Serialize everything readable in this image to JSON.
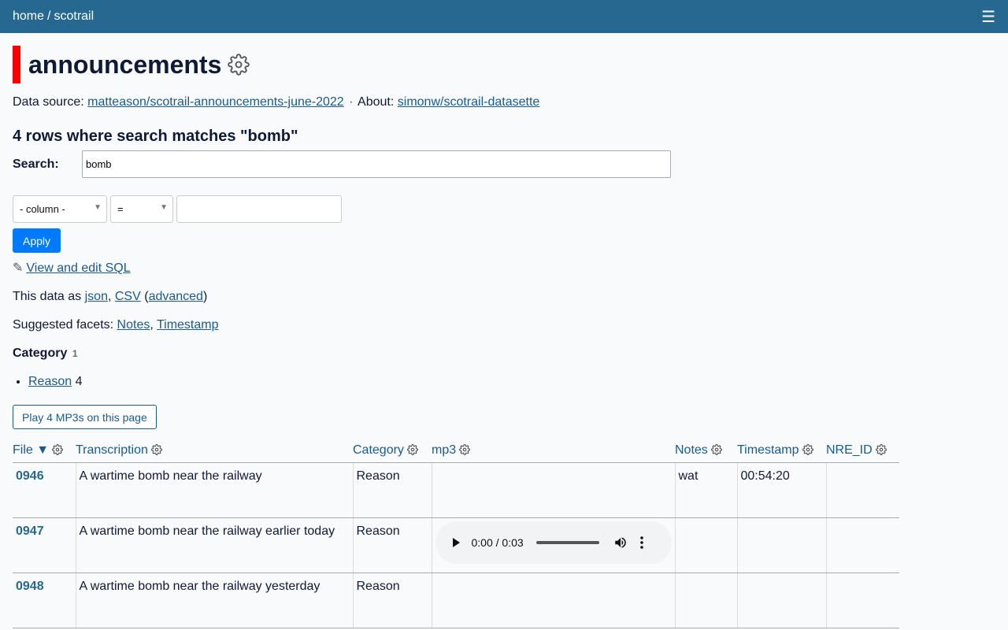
{
  "nav": {
    "home": "home",
    "separator": "/",
    "db": "scotrail",
    "menu_glyph": "☰"
  },
  "page": {
    "title": "announcements",
    "source_label": "Data source:",
    "source_link": "matteason/scotrail-announcements-june-2022",
    "about_sep": "·",
    "about_label": "About:",
    "about_link": "simonw/scotrail-datasette"
  },
  "search": {
    "heading": "4 rows where search matches \"bomb\"",
    "label": "Search:",
    "value": "bomb"
  },
  "filter": {
    "column": "- column -",
    "op": "=",
    "value": "",
    "apply": "Apply"
  },
  "sql": {
    "pencil": "✎",
    "link": "View and edit SQL"
  },
  "export": {
    "prefix": "This data as",
    "json": "json",
    "comma": ",",
    "csv": "CSV",
    "open": "(",
    "advanced": "advanced",
    "close": ")"
  },
  "facets": {
    "prefix": "Suggested facets:",
    "items": [
      "Notes",
      "Timestamp"
    ],
    "comma": ","
  },
  "category_facet": {
    "title": "Category",
    "count": "1",
    "items": [
      {
        "label": "Reason",
        "count": "4"
      }
    ]
  },
  "play_button": "Play 4 MP3s on this page",
  "table": {
    "columns": [
      {
        "label": "File ▼"
      },
      {
        "label": "Transcription"
      },
      {
        "label": "Category"
      },
      {
        "label": "mp3"
      },
      {
        "label": "Notes"
      },
      {
        "label": "Timestamp"
      },
      {
        "label": "NRE_ID"
      }
    ],
    "rows": [
      {
        "file": "0946",
        "transcription": "A wartime bomb near the railway",
        "category": "Reason",
        "mp3": "",
        "notes": "wat",
        "timestamp": "00:54:20",
        "nre_id": ""
      },
      {
        "file": "0947",
        "transcription": "A wartime bomb near the railway earlier today",
        "category": "Reason",
        "mp3": "0:00 / 0:03",
        "notes": "",
        "timestamp": "",
        "nre_id": ""
      },
      {
        "file": "0948",
        "transcription": "A wartime bomb near the railway yesterday",
        "category": "Reason",
        "mp3": "",
        "notes": "",
        "timestamp": "",
        "nre_id": ""
      }
    ]
  },
  "colors": {
    "topbar": "#276890",
    "title_bar": "#ff0000",
    "apply": "#007bff",
    "link": "#1a5a8c"
  }
}
